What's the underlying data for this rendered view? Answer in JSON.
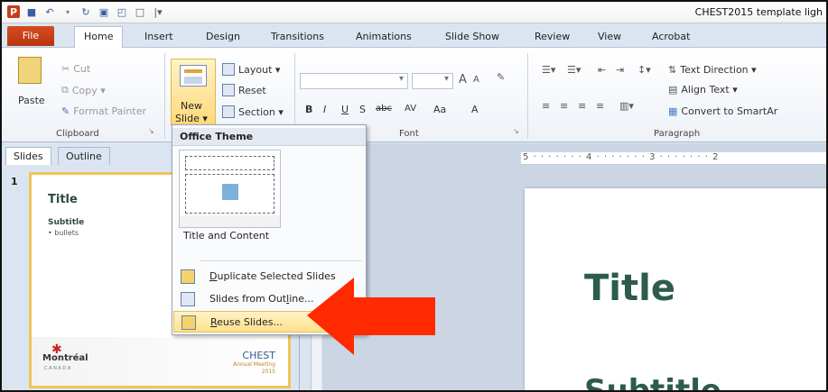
{
  "window": {
    "title": "CHEST2015 template ligh"
  },
  "tabs": [
    "File",
    "Home",
    "Insert",
    "Design",
    "Transitions",
    "Animations",
    "Slide Show",
    "Review",
    "View",
    "Acrobat"
  ],
  "ribbon": {
    "clipboard": {
      "paste": "Paste",
      "cut": "Cut",
      "copy": "Copy ▾",
      "format_painter": "Format Painter",
      "label": "Clipboard"
    },
    "slides": {
      "new_slide_1": "New",
      "new_slide_2": "Slide ▾",
      "layout": "Layout ▾",
      "reset": "Reset",
      "section": "Section ▾"
    },
    "font": {
      "label": "Font",
      "bold": "B",
      "italic": "I",
      "underline": "U",
      "shadow": "S",
      "strike": "abc",
      "spacing": "AV",
      "case": "Aa",
      "color": "A",
      "grow": "A",
      "shrink": "A"
    },
    "paragraph": {
      "label": "Paragraph",
      "text_direction": "Text Direction ▾",
      "align_text": "Align Text ▾",
      "convert": "Convert to SmartAr"
    }
  },
  "left_pane": {
    "tabs": [
      "Slides",
      "Outline"
    ],
    "slide_number": "1",
    "thumb": {
      "title": "Title",
      "subtitle": "Subtitle",
      "bullet": "• bullets",
      "montreal": "Montréal",
      "canada": "C A N A D A",
      "chest": "CHEST",
      "annual": "Annual Meeting",
      "year": "2015"
    }
  },
  "slide": {
    "title": "Title",
    "subtitle": "Subtitle"
  },
  "ruler": {
    "marks": "5 · · · · · · · 4 · · · · · · · 3 · · · · · · · 2"
  },
  "menu": {
    "header": "Office Theme",
    "layout_label": "Title and Content",
    "items": [
      {
        "label_pre": "",
        "label_u": "D",
        "label_post": "uplicate Selected Slides"
      },
      {
        "label_pre": "Slides from Out",
        "label_u": "l",
        "label_post": "ine..."
      },
      {
        "label_pre": "",
        "label_u": "R",
        "label_post": "euse Slides..."
      }
    ]
  },
  "colors": {
    "accent_arrow": "#ff2a00",
    "title_green": "#2d5c4a",
    "highlight": "#ffe08c"
  }
}
